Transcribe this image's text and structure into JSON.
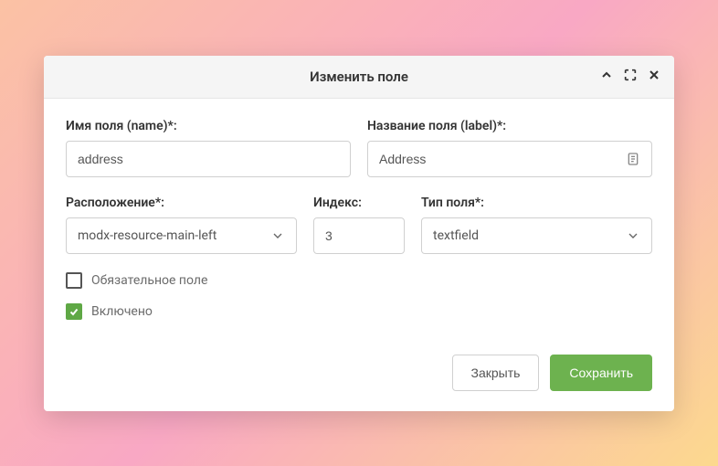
{
  "modal": {
    "title": "Изменить поле"
  },
  "fields": {
    "name": {
      "label": "Имя поля (name)*:",
      "value": "address"
    },
    "label": {
      "label": "Название поля (label)*:",
      "value": "Address"
    },
    "location": {
      "label": "Расположение*:",
      "value": "modx-resource-main-left"
    },
    "index": {
      "label": "Индекс:",
      "value": "3"
    },
    "type": {
      "label": "Тип поля*:",
      "value": "textfield"
    }
  },
  "checkboxes": {
    "required": {
      "label": "Обязательное поле",
      "checked": false
    },
    "enabled": {
      "label": "Включено",
      "checked": true
    }
  },
  "buttons": {
    "close": "Закрыть",
    "save": "Сохранить"
  }
}
